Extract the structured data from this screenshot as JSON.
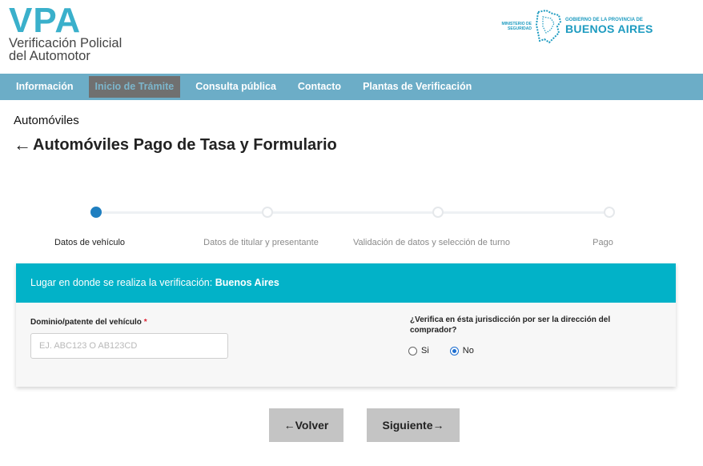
{
  "logo": {
    "mark": "VPA",
    "line1": "Verificación Policial",
    "line2": "del Automotor"
  },
  "gov": {
    "ministry_line1": "MINISTERIO DE",
    "ministry_line2": "SEGURIDAD",
    "province_small": "GOBIERNO DE LA PROVINCIA DE",
    "province_big": "BUENOS AIRES"
  },
  "nav": {
    "items": [
      {
        "label": "Información"
      },
      {
        "label": "Inicio de Trámite",
        "active": true
      },
      {
        "label": "Consulta pública"
      },
      {
        "label": "Contacto"
      },
      {
        "label": "Plantas de Verificación"
      }
    ]
  },
  "breadcrumb": "Automóviles",
  "page_title": "Automóviles Pago de Tasa y Formulario",
  "stepper": {
    "steps": [
      {
        "label": "Datos de vehículo",
        "active": true
      },
      {
        "label": "Datos de titular y presentante"
      },
      {
        "label": "Validación de datos y selección de turno"
      },
      {
        "label": "Pago"
      }
    ]
  },
  "card": {
    "header_prefix": "Lugar en donde se realiza la verificación: ",
    "header_value": "Buenos Aires",
    "domain_label": "Dominio/patente del vehículo",
    "required_mark": "*",
    "domain_value": "",
    "domain_placeholder": "EJ. ABC123 O AB123CD",
    "question": "¿Verifica en ésta jurisdicción por ser la dirección del comprador?",
    "options": [
      {
        "label": "Si",
        "checked": false
      },
      {
        "label": "No",
        "checked": true
      }
    ]
  },
  "buttons": {
    "back_label": "Volver",
    "next_label": "Siguiente"
  },
  "colors": {
    "accent": "#3ab0cb",
    "nav_bg": "#6cadc7",
    "card_header": "#02b2c8",
    "step_active": "#1f7fc0",
    "button_bg": "#c4c4c4"
  }
}
